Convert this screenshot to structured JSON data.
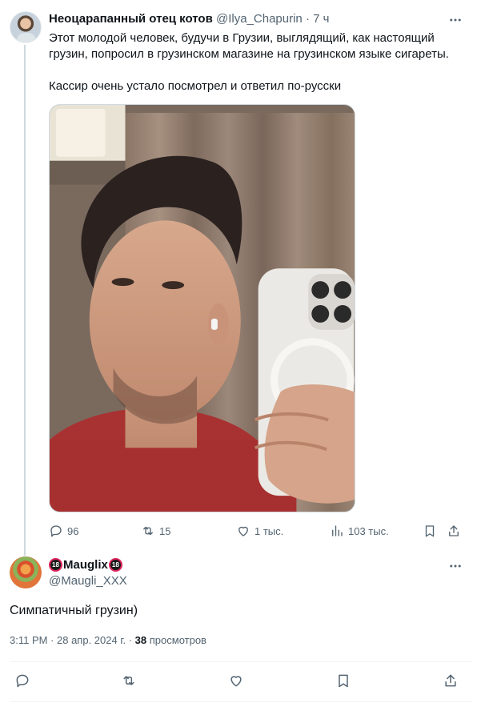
{
  "tweet": {
    "author_name": "Неоцарапанный отец котов",
    "handle": "@Ilya_Chapurin",
    "separator": "·",
    "time": "7 ч",
    "text_line1": "Этот молодой человек, будучи в Грузии, выглядящий, как настоящий грузин, попросил в грузинском магазине на грузинском языке сигареты.",
    "text_line2": "Кассир очень устало посмотрел и ответил по-русски",
    "stats": {
      "replies": "96",
      "reposts": "15",
      "likes": "1 тыс.",
      "views": "103 тыс."
    }
  },
  "reply": {
    "badge": "18",
    "author_name": "Mauglix",
    "handle": "@Maugli_XXX",
    "text": "Симпатичный грузин)",
    "timestamp": "3:11 PM · 28 апр. 2024 г. ·",
    "views_count": "38",
    "views_label": "просмотров"
  },
  "icons": {
    "more": "more-horizontal-icon",
    "reply": "reply-bubble-icon",
    "repost": "repost-icon",
    "like": "heart-icon",
    "views": "analytics-icon",
    "bookmark": "bookmark-icon",
    "share": "share-icon"
  },
  "colors": {
    "text_primary": "#0f1419",
    "text_secondary": "#536471",
    "divider": "#eff3f4",
    "thread_line": "#cfd9de",
    "badge_ring": "#e0245e"
  }
}
